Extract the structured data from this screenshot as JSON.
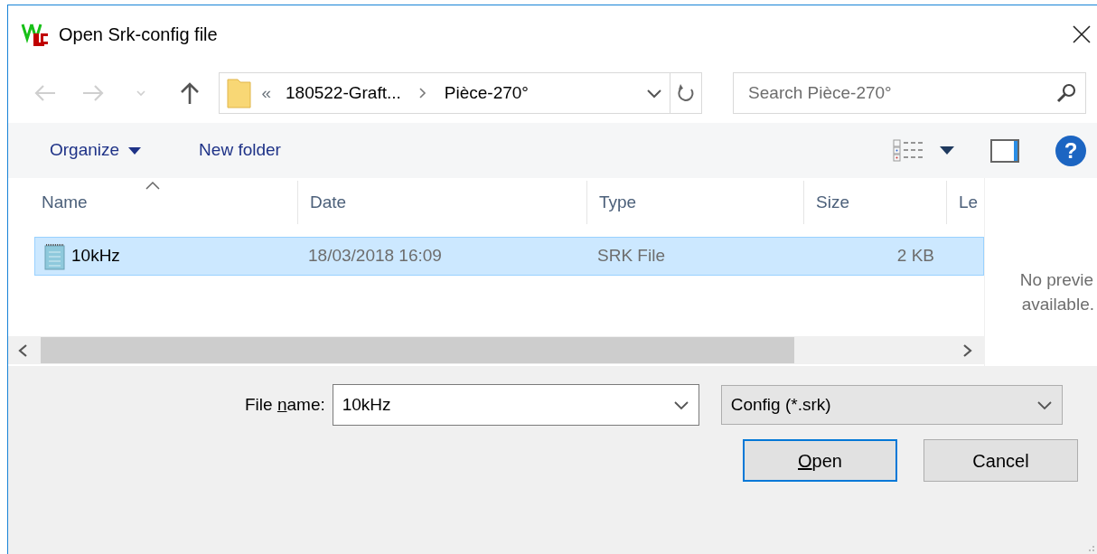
{
  "window": {
    "title": "Open Srk-config file"
  },
  "navigation": [
    {
      "kind": "back",
      "disabled": true
    },
    {
      "kind": "forward",
      "disabled": true
    },
    {
      "kind": "recent",
      "disabled": true
    },
    {
      "kind": "up",
      "disabled": false
    }
  ],
  "address_bar": {
    "overflow": "«",
    "breadcrumbs": [
      "180522-Graft...",
      "Pièce-270°"
    ]
  },
  "search": {
    "placeholder": "Search Pièce-270°"
  },
  "toolbar": {
    "organize": "Organize",
    "new_folder": "New folder",
    "help": "?"
  },
  "columns": [
    {
      "label": "Name",
      "sorted": true
    },
    {
      "label": "Date",
      "sorted": false
    },
    {
      "label": "Type",
      "sorted": false
    },
    {
      "label": "Size",
      "sorted": false
    },
    {
      "label": "Le",
      "sorted": false
    }
  ],
  "files": [
    {
      "name": "10kHz",
      "date": "18/03/2018 16:09",
      "type": "SRK File",
      "size": "2 KB",
      "selected": true
    }
  ],
  "preview": {
    "lines": [
      "No previe",
      "available."
    ]
  },
  "file_name": {
    "label_parts": [
      {
        "text": "File ",
        "underlined": false
      },
      {
        "text": "n",
        "underlined": true
      },
      {
        "text": "ame:",
        "underlined": false
      }
    ],
    "value": "10kHz"
  },
  "file_type": {
    "value": "Config (*.srk)"
  },
  "buttons": [
    {
      "label_parts": [
        {
          "text": "O",
          "underlined": true
        },
        {
          "text": "pen",
          "underlined": false
        }
      ],
      "default": true
    },
    {
      "label_parts": [
        {
          "text": "Cancel",
          "underlined": false
        }
      ],
      "default": false
    }
  ]
}
